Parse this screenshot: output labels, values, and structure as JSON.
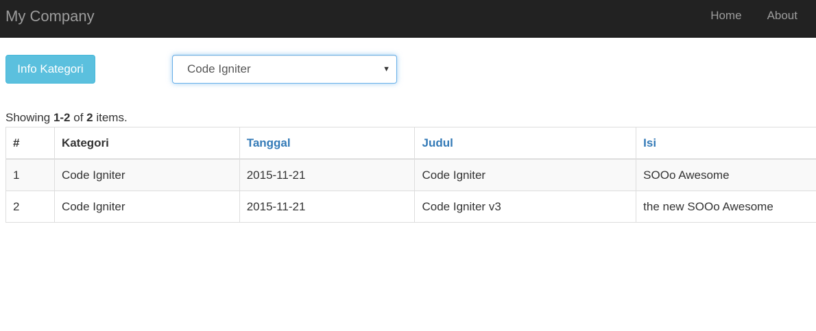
{
  "navbar": {
    "brand": "My Company",
    "links": [
      {
        "label": "Home"
      },
      {
        "label": "About"
      }
    ]
  },
  "toolbar": {
    "info_button_label": "Info Kategori",
    "category_select": {
      "selected": "Code Igniter"
    }
  },
  "summary": {
    "prefix": "Showing ",
    "range": "1-2",
    "middle": " of ",
    "total": "2",
    "suffix": " items."
  },
  "table": {
    "headers": [
      {
        "label": "#",
        "sortable": false
      },
      {
        "label": "Kategori",
        "sortable": false
      },
      {
        "label": "Tanggal",
        "sortable": true
      },
      {
        "label": "Judul",
        "sortable": true
      },
      {
        "label": "Isi",
        "sortable": true
      }
    ],
    "rows": [
      {
        "no": "1",
        "kategori": "Code Igniter",
        "tanggal": "2015-11-21",
        "judul": "Code Igniter",
        "isi": "SOOo Awesome"
      },
      {
        "no": "2",
        "kategori": "Code Igniter",
        "tanggal": "2015-11-21",
        "judul": "Code Igniter v3",
        "isi": "the new SOOo Awesome"
      }
    ]
  },
  "colors": {
    "navbar_bg": "#222222",
    "navbar_text": "#9d9d9d",
    "info_button_bg": "#5bc0de",
    "link_blue": "#337ab7",
    "focus_border": "#66afe9",
    "striped_row": "#f9f9f9"
  }
}
